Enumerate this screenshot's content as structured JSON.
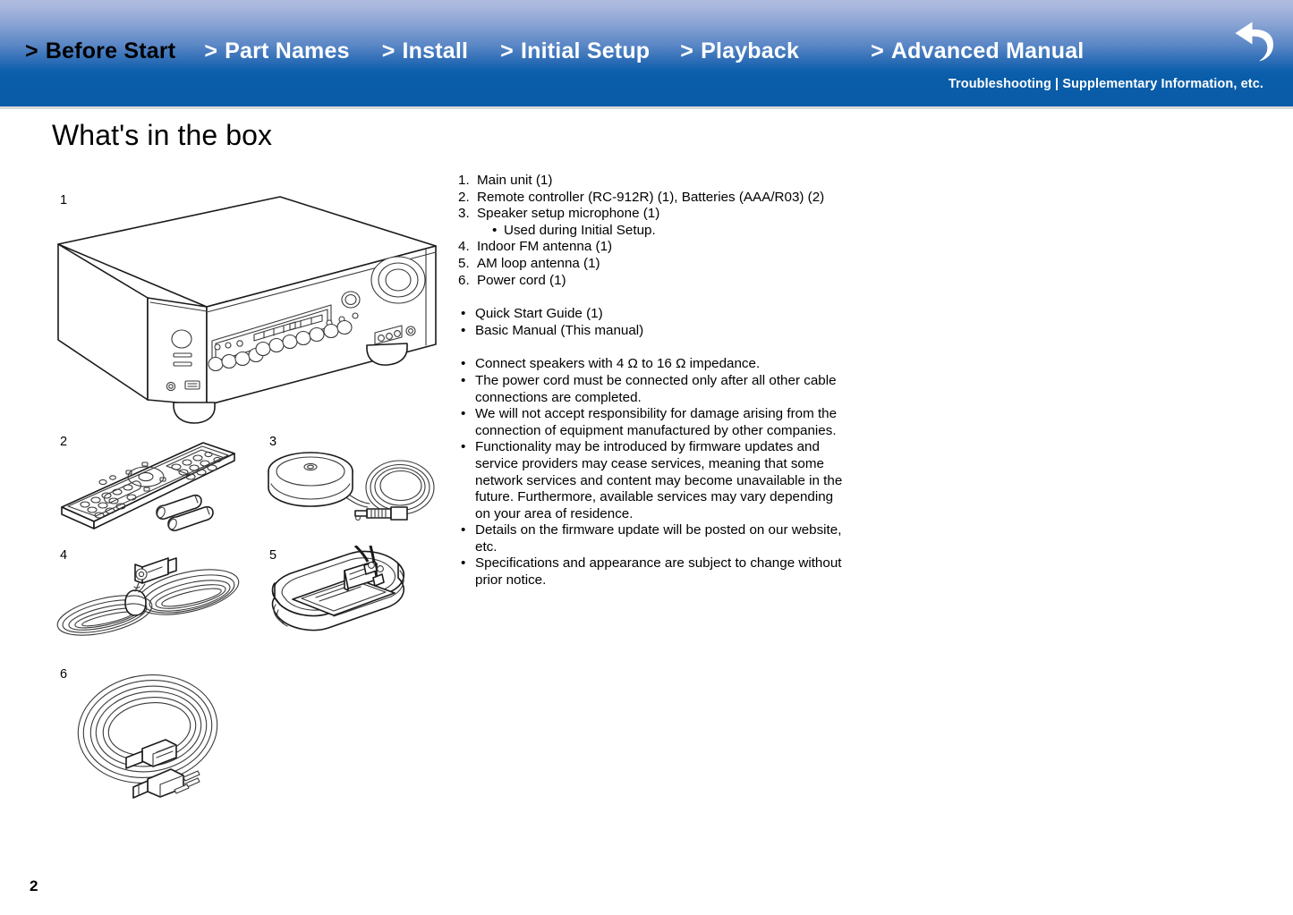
{
  "header": {
    "nav_items": [
      {
        "chevron": ">",
        "label": "Before Start",
        "active": true
      },
      {
        "chevron": ">",
        "label": "Part Names",
        "active": false
      },
      {
        "chevron": ">",
        "label": "Install",
        "active": false
      },
      {
        "chevron": ">",
        "label": "Initial Setup",
        "active": false
      },
      {
        "chevron": ">",
        "label": "Playback",
        "active": false
      },
      {
        "chevron": ">",
        "label": "Advanced Manual",
        "active": false
      }
    ],
    "subnav_text": "Troubleshooting | Supplementary Information, etc.",
    "back_button_name": "back-arrow-icon",
    "colors": {
      "gradient_top": "#aebbdf",
      "gradient_bottom": "#0a5ca8",
      "active_nav_text": "#000000",
      "nav_text": "#ffffff",
      "rule": "#d8d8d8"
    }
  },
  "page": {
    "title": "What's in the box",
    "page_number": "2"
  },
  "figures": [
    {
      "number": "1",
      "caption": "main-unit-av-receiver"
    },
    {
      "number": "2",
      "caption": "remote-controller-and-batteries"
    },
    {
      "number": "3",
      "caption": "speaker-setup-microphone"
    },
    {
      "number": "4",
      "caption": "indoor-fm-antenna"
    },
    {
      "number": "5",
      "caption": "am-loop-antenna"
    },
    {
      "number": "6",
      "caption": "power-cord"
    }
  ],
  "contents": {
    "numbered_items": [
      {
        "marker": "1.",
        "text": "Main unit (1)",
        "sub": []
      },
      {
        "marker": "2.",
        "text": "Remote controller (RC-912R) (1), Batteries (AAA/R03) (2)",
        "sub": []
      },
      {
        "marker": "3.",
        "text": "Speaker setup microphone (1)",
        "sub": [
          "Used during Initial Setup."
        ]
      },
      {
        "marker": "4.",
        "text": "Indoor FM antenna (1)",
        "sub": []
      },
      {
        "marker": "5.",
        "text": "AM loop antenna (1)",
        "sub": []
      },
      {
        "marker": "6.",
        "text": "Power cord (1)",
        "sub": []
      }
    ],
    "documents": [
      "Quick Start Guide (1)",
      "Basic Manual (This manual)"
    ],
    "notes": [
      "Connect speakers with 4 Ω to 16 Ω impedance.",
      "The power cord must be connected only after all other cable connections are completed.",
      "We will not accept responsibility for damage arising from the connection of equipment manufactured by other companies.",
      "Functionality may be introduced by firmware updates and service providers may cease services, meaning that some network services and content may become unavailable in the future. Furthermore, available services may vary depending on your area of residence.",
      "Details on the firmware update will be posted on our website, etc.",
      "Specifications and appearance are subject to change without prior notice."
    ]
  }
}
